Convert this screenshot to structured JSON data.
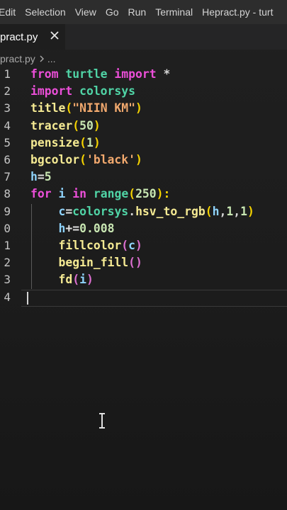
{
  "menubar": {
    "items": [
      "Edit",
      "Selection",
      "View",
      "Go",
      "Run",
      "Terminal"
    ],
    "window_title": "Hepract.py - turt"
  },
  "tab": {
    "label": "pract.py",
    "close_glyph": "×"
  },
  "breadcrumb": {
    "file": "pract.py",
    "ellipsis": "..."
  },
  "editor": {
    "lines": [
      {
        "number": "1",
        "tokens": [
          {
            "t": "from ",
            "c": "kw"
          },
          {
            "t": "turtle ",
            "c": "mod"
          },
          {
            "t": "import ",
            "c": "kw"
          },
          {
            "t": "*",
            "c": "plain"
          }
        ]
      },
      {
        "number": "2",
        "tokens": [
          {
            "t": "import ",
            "c": "kw"
          },
          {
            "t": "colorsys",
            "c": "mod"
          }
        ]
      },
      {
        "number": "3",
        "tokens": [
          {
            "t": "title",
            "c": "fn"
          },
          {
            "t": "(",
            "c": "paren-y"
          },
          {
            "t": "\"NIIN KM\"",
            "c": "str"
          },
          {
            "t": ")",
            "c": "paren-y"
          }
        ]
      },
      {
        "number": "4",
        "tokens": [
          {
            "t": "tracer",
            "c": "fn"
          },
          {
            "t": "(",
            "c": "paren-y"
          },
          {
            "t": "50",
            "c": "num"
          },
          {
            "t": ")",
            "c": "paren-y"
          }
        ]
      },
      {
        "number": "5",
        "tokens": [
          {
            "t": "pensize",
            "c": "fn"
          },
          {
            "t": "(",
            "c": "paren-y"
          },
          {
            "t": "1",
            "c": "num"
          },
          {
            "t": ")",
            "c": "paren-y"
          }
        ]
      },
      {
        "number": "6",
        "tokens": [
          {
            "t": "bgcolor",
            "c": "fn"
          },
          {
            "t": "(",
            "c": "paren-y"
          },
          {
            "t": "'black'",
            "c": "str"
          },
          {
            "t": ")",
            "c": "paren-y"
          }
        ]
      },
      {
        "number": "7",
        "tokens": [
          {
            "t": "h",
            "c": "var"
          },
          {
            "t": "=",
            "c": "op"
          },
          {
            "t": "5",
            "c": "num"
          }
        ]
      },
      {
        "number": "8",
        "tokens": [
          {
            "t": "for ",
            "c": "kw"
          },
          {
            "t": "i ",
            "c": "var"
          },
          {
            "t": "in ",
            "c": "kw"
          },
          {
            "t": "range",
            "c": "mod"
          },
          {
            "t": "(",
            "c": "paren-y"
          },
          {
            "t": "250",
            "c": "num"
          },
          {
            "t": "):",
            "c": "paren-y"
          }
        ]
      },
      {
        "number": "9",
        "tokens": [
          {
            "t": "    ",
            "c": "plain"
          },
          {
            "t": "c",
            "c": "var"
          },
          {
            "t": "=",
            "c": "op"
          },
          {
            "t": "colorsys",
            "c": "mod"
          },
          {
            "t": ".",
            "c": "plain"
          },
          {
            "t": "hsv_to_rgb",
            "c": "fn"
          },
          {
            "t": "(",
            "c": "paren-y"
          },
          {
            "t": "h",
            "c": "var"
          },
          {
            "t": ",",
            "c": "plain"
          },
          {
            "t": "1",
            "c": "num"
          },
          {
            "t": ",",
            "c": "plain"
          },
          {
            "t": "1",
            "c": "num"
          },
          {
            "t": ")",
            "c": "paren-y"
          }
        ]
      },
      {
        "number": "0",
        "tokens": [
          {
            "t": "    ",
            "c": "plain"
          },
          {
            "t": "h",
            "c": "var"
          },
          {
            "t": "+=",
            "c": "op"
          },
          {
            "t": "0.008",
            "c": "num"
          }
        ]
      },
      {
        "number": "1",
        "tokens": [
          {
            "t": "    ",
            "c": "plain"
          },
          {
            "t": "fillcolor",
            "c": "fn"
          },
          {
            "t": "(",
            "c": "paren-p"
          },
          {
            "t": "c",
            "c": "var"
          },
          {
            "t": ")",
            "c": "paren-p"
          }
        ]
      },
      {
        "number": "2",
        "tokens": [
          {
            "t": "    ",
            "c": "plain"
          },
          {
            "t": "begin_fill",
            "c": "fn"
          },
          {
            "t": "()",
            "c": "paren-p"
          }
        ]
      },
      {
        "number": "3",
        "tokens": [
          {
            "t": "    ",
            "c": "plain"
          },
          {
            "t": "fd",
            "c": "fn"
          },
          {
            "t": "(",
            "c": "paren-p"
          },
          {
            "t": "i",
            "c": "var"
          },
          {
            "t": ")",
            "c": "paren-p"
          }
        ]
      },
      {
        "number": "4",
        "tokens": []
      }
    ]
  },
  "colors": {
    "keyword": "#ec4fd9",
    "function": "#f5ea93",
    "module": "#50d4a6",
    "string": "#f2a96e",
    "number": "#c8e6b2",
    "variable": "#8fd3fb",
    "background": "#1e1e1e"
  },
  "icons": {
    "tab_close": "close-icon",
    "breadcrumb_separator": "chevron-right-icon",
    "mouse_cursor": "text-cursor-icon"
  }
}
